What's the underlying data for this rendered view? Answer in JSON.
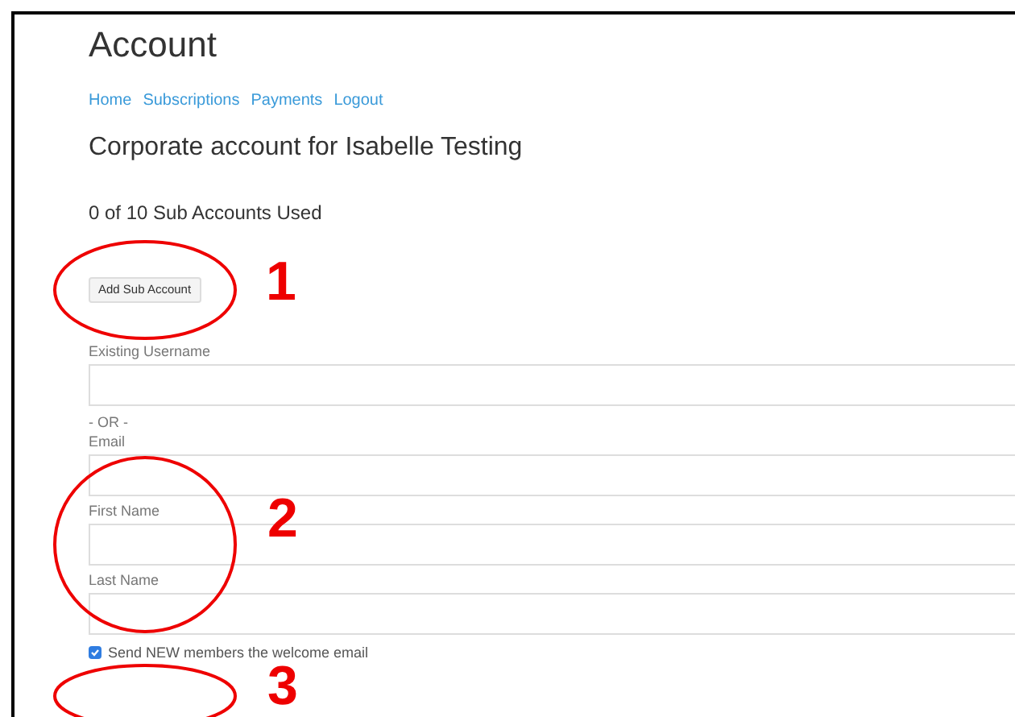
{
  "title": "Account",
  "nav": [
    {
      "label": "Home"
    },
    {
      "label": "Subscriptions"
    },
    {
      "label": "Payments"
    },
    {
      "label": "Logout"
    }
  ],
  "heading": "Corporate account for Isabelle Testing",
  "usage": "0 of 10 Sub Accounts Used",
  "add_button": "Add Sub Account",
  "fields": [
    {
      "label": "Existing Username"
    },
    {
      "kind": "separator",
      "label": "- OR -"
    },
    {
      "label": "Email"
    },
    {
      "label": "First Name"
    },
    {
      "label": "Last Name"
    }
  ],
  "welcome_checkbox": {
    "label": "Send NEW members the welcome email",
    "checked": true
  },
  "annotations": [
    {
      "number": "1"
    },
    {
      "number": "2"
    },
    {
      "number": "3"
    }
  ]
}
